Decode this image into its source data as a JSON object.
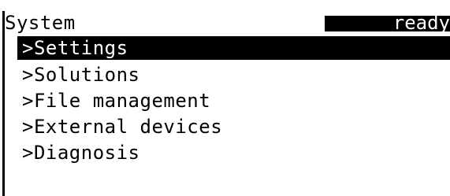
{
  "header": {
    "title": "System",
    "status": "ready"
  },
  "menu": {
    "items": [
      {
        "label": ">Settings",
        "selected": true
      },
      {
        "label": ">Solutions",
        "selected": false
      },
      {
        "label": ">File management",
        "selected": false
      },
      {
        "label": ">External devices",
        "selected": false
      },
      {
        "label": ">Diagnosis",
        "selected": false
      }
    ]
  },
  "colors": {
    "background": "#ffffff",
    "foreground": "#000000",
    "highlight_background": "#000000",
    "highlight_text": "#ffffff"
  }
}
